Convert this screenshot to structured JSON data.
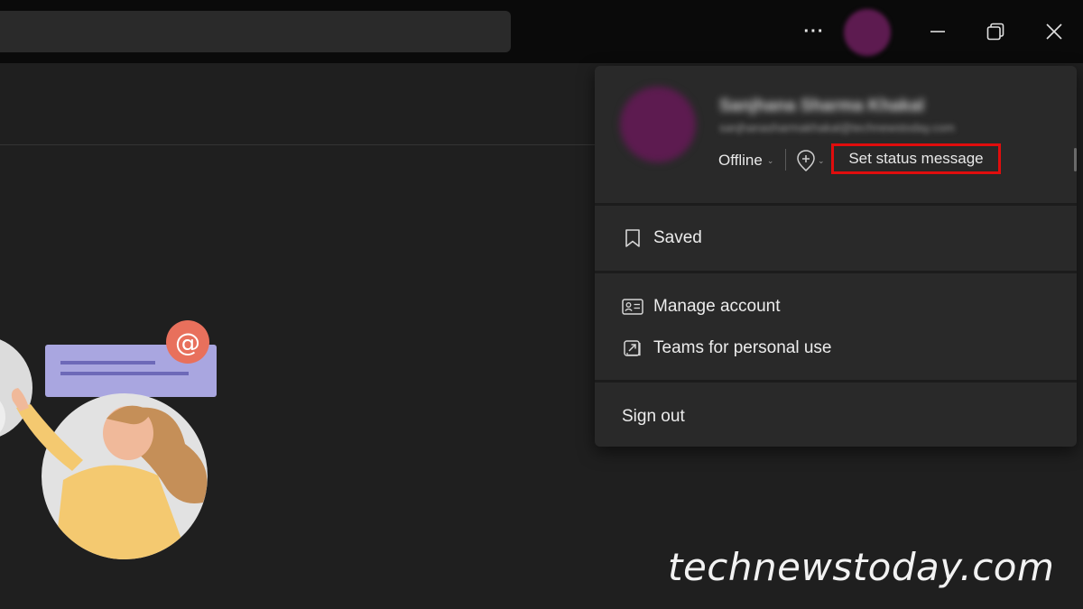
{
  "topbar": {
    "search_value": "",
    "more_label": "···",
    "avatar_color": "#5d1b50",
    "window_controls": [
      "minimize-icon",
      "restore-icon",
      "close-icon"
    ]
  },
  "profile_menu": {
    "user_name": "Sanjhana Sharma Khakal",
    "user_email": "sanjhanasharmakhakal@technewstoday.com",
    "presence": "Offline",
    "set_status_label": "Set status message",
    "highlight_color": "#e00d0d",
    "items": [
      {
        "label": "Saved",
        "icon": "bookmark-icon"
      },
      {
        "label": "Manage account",
        "icon": "id-card-icon"
      },
      {
        "label": "Teams for personal use",
        "icon": "external-link-icon"
      },
      {
        "label": "Sign out"
      }
    ]
  },
  "illustration": {
    "mention_symbol": "@",
    "card_color": "#a9a6e0",
    "mention_color": "#e8705c"
  },
  "watermark": "technewstoday.com"
}
